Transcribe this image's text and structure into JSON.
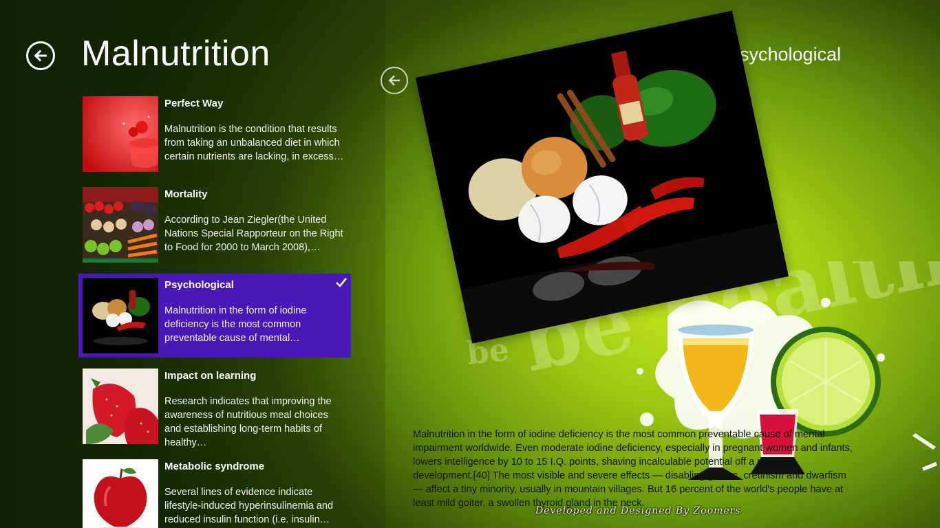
{
  "page": {
    "title": "Malnutrition",
    "footer_credit": "Developed and Designed By Zoomers",
    "background_text": "be healthy"
  },
  "colors": {
    "selected_item": "#4a17b8",
    "accent_green": "#a2cc12"
  },
  "icons": {
    "back": "back-arrow-circle-icon",
    "selected": "checkmark-icon"
  },
  "items": [
    {
      "title": "Perfect Way",
      "desc": "Malnutrition is the condition that results from taking an unbalanced diet in which certain nutrients are lacking, in excess…",
      "image": "red-fruit-splash",
      "selected": false
    },
    {
      "title": "Mortality",
      "desc": "According to Jean Ziegler(the United Nations Special Rapporteur on the Right to Food for 2000 to March 2008),…",
      "image": "vegetable-market",
      "selected": false
    },
    {
      "title": "Psychological",
      "desc": "Malnutrition in the form of iodine deficiency is the most common preventable cause of mental…",
      "image": "peppers-and-garlic",
      "selected": true
    },
    {
      "title": "Impact on learning",
      "desc": "Research indicates that improving the awareness of nutritious meal choices and establishing long-term habits of healthy…",
      "image": "strawberries",
      "selected": false
    },
    {
      "title": "Metabolic syndrome",
      "desc": "Several lines of evidence indicate lifestyle-induced hyperinsulinemia and reduced insulin function (i.e. insulin…",
      "image": "red-apple",
      "selected": false
    }
  ],
  "detail": {
    "title": "Psychological",
    "image": "peppers-garlic-onion-tabasco",
    "body": "Malnutrition in the form of iodine deficiency is the most common preventable cause of mental impairment worldwide. Even moderate iodine deficiency, especially in pregnant women and infants, lowers intelligence by 10 to 15 I.Q. points, shaving incalculable potential off a nation's development.[40] The most visible and severe effects — disabling goiters, cretinism and dwarfism — affect a tiny minority, usually in mountain villages. But 16 percent of the world's people have at least mild goiter, a swollen thyroid gland in the neck."
  }
}
